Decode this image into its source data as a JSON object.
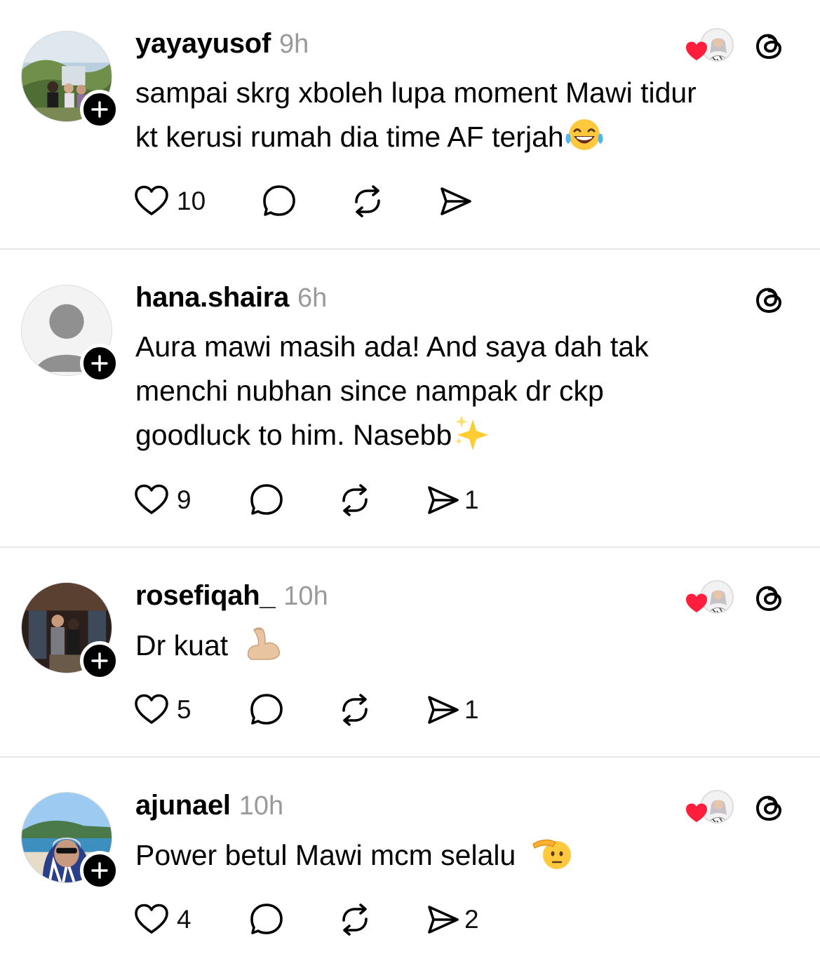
{
  "posts": [
    {
      "username": "yayayusof",
      "time": "9h",
      "text_lines": [
        "sampai skrg xboleh lupa moment Mawi tidur",
        "kt kerusi rumah dia time AF terjah"
      ],
      "emoji": "face-with-tears-of-joy",
      "likes": "10",
      "reposts": "",
      "shares": "",
      "liked_by_author": true,
      "avatar": "outdoor-group-photo"
    },
    {
      "username": "hana.shaira",
      "time": "6h",
      "text_lines": [
        "Aura mawi masih ada! And saya dah tak",
        "menchi nubhan since nampak dr ckp",
        "goodluck to him. Nasebb"
      ],
      "emoji": "sparkles",
      "likes": "9",
      "shares": "1",
      "liked_by_author": false,
      "avatar": "default-profile"
    },
    {
      "username": "rosefiqah_",
      "time": "10h",
      "text_lines": [
        "Dr kuat"
      ],
      "emoji": "flexed-biceps",
      "likes": "5",
      "shares": "1",
      "liked_by_author": true,
      "avatar": "couple-indoor-photo"
    },
    {
      "username": "ajunael",
      "time": "10h",
      "text_lines": [
        "Power betul Mawi mcm selalu"
      ],
      "emoji": "saluting-face",
      "likes": "4",
      "shares": "2",
      "liked_by_author": true,
      "avatar": "beach-selfie"
    }
  ],
  "colors": {
    "heart_red": "#ff1e3c",
    "time_gray": "#9a9a9a",
    "divider": "#e6e6e6"
  },
  "icons": [
    "heart-icon",
    "comment-icon",
    "repost-icon",
    "share-icon",
    "threads-logo-icon",
    "follow-plus-icon"
  ]
}
